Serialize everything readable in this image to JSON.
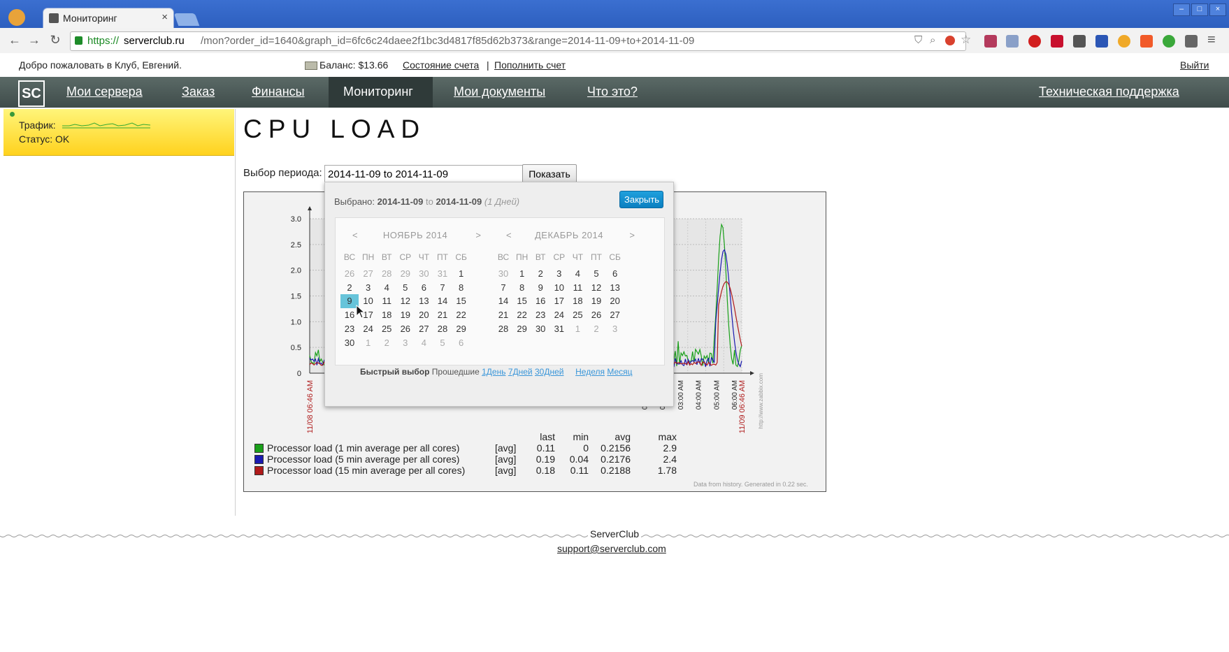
{
  "browser": {
    "tab_title": "Мониторинг",
    "url_protocol": "https://",
    "url_host": "serverclub.ru",
    "url_path": "/mon?order_id=1640&graph_id=6fc6c24daee2f1bc3d4817f85d62b373&range=2014-11-09+to+2014-11-09"
  },
  "header": {
    "welcome": "Добро пожаловать в Клуб, Евгений.",
    "balance": "Баланс: $13.66",
    "account_state": "Состояние счета",
    "separator": "|",
    "top_up": "Пополнить счет",
    "logout": "Выйти"
  },
  "nav": {
    "servers": "Мои сервера",
    "order": "Заказ",
    "finance": "Финансы",
    "monitoring": "Мониторинг",
    "documents": "Мои документы",
    "what": "Что это?",
    "support": "Техническая поддержка"
  },
  "status": {
    "traffic_label": "Трафик:",
    "status_label": "Статус: OK"
  },
  "page": {
    "title": "CPU LOAD",
    "period_label": "Выбор периода:",
    "period_value": "2014-11-09 to 2014-11-09",
    "show_button": "Показать"
  },
  "picker": {
    "selected_label": "Выбрано:",
    "from": "2014-11-09",
    "to_word": "to",
    "to": "2014-11-09",
    "days": "(1 Дней)",
    "close": "Закрыть",
    "quick_label": "Быстрый выбор",
    "past_label": "Прошедшие",
    "q1": "1День",
    "q7": "7Дней",
    "q30": "30Дней",
    "week": "Неделя",
    "month": "Месяц",
    "prev": "<",
    "next": ">",
    "dow": [
      "ВС",
      "ПН",
      "ВТ",
      "СР",
      "ЧТ",
      "ПТ",
      "СБ"
    ],
    "months": [
      {
        "name": "НОЯБРЬ 2014",
        "days": [
          [
            "26",
            "27",
            "28",
            "29",
            "30",
            "31",
            "1"
          ],
          [
            "2",
            "3",
            "4",
            "5",
            "6",
            "7",
            "8"
          ],
          [
            "9",
            "10",
            "11",
            "12",
            "13",
            "14",
            "15"
          ],
          [
            "16",
            "17",
            "18",
            "19",
            "20",
            "21",
            "22"
          ],
          [
            "23",
            "24",
            "25",
            "26",
            "27",
            "28",
            "29"
          ],
          [
            "30",
            "1",
            "2",
            "3",
            "4",
            "5",
            "6"
          ]
        ],
        "muted": [
          [
            0,
            0
          ],
          [
            0,
            1
          ],
          [
            0,
            2
          ],
          [
            0,
            3
          ],
          [
            0,
            4
          ],
          [
            0,
            5
          ],
          [
            5,
            1
          ],
          [
            5,
            2
          ],
          [
            5,
            3
          ],
          [
            5,
            4
          ],
          [
            5,
            5
          ],
          [
            5,
            6
          ]
        ],
        "selected": [
          2,
          0
        ]
      },
      {
        "name": "ДЕКАБРЬ 2014",
        "days": [
          [
            "30",
            "1",
            "2",
            "3",
            "4",
            "5",
            "6"
          ],
          [
            "7",
            "8",
            "9",
            "10",
            "11",
            "12",
            "13"
          ],
          [
            "14",
            "15",
            "16",
            "17",
            "18",
            "19",
            "20"
          ],
          [
            "21",
            "22",
            "23",
            "24",
            "25",
            "26",
            "27"
          ],
          [
            "28",
            "29",
            "30",
            "31",
            "1",
            "2",
            "3"
          ]
        ],
        "muted": [
          [
            0,
            0
          ],
          [
            4,
            4
          ],
          [
            4,
            5
          ],
          [
            4,
            6
          ]
        ],
        "selected": null
      }
    ]
  },
  "chart_data": {
    "type": "line",
    "ylim": [
      0,
      3.0
    ],
    "yticks": [
      "0",
      "0.5",
      "1.0",
      "1.5",
      "2.0",
      "2.5",
      "3.0"
    ],
    "xticks_visible": [
      "01:00 AM",
      "02:00 AM",
      "03:00 AM",
      "04:00 AM",
      "05:00 AM",
      "06:00 AM"
    ],
    "start_label": "11/08 06:46 AM",
    "end_label": "11/09 06:46 AM",
    "watermark": "http://www.zabbix.com",
    "generated": "Data from history. Generated in 0.22 sec.",
    "legend_headers": [
      "last",
      "min",
      "avg",
      "max"
    ],
    "series": [
      {
        "name": "Processor load (1 min average per all cores)",
        "color": "#1aa01a",
        "agg": "[avg]",
        "last": "0.11",
        "min": "0",
        "avg": "0.2156",
        "max": "2.9"
      },
      {
        "name": "Processor load (5 min average per all cores)",
        "color": "#1a1ab0",
        "agg": "[avg]",
        "last": "0.19",
        "min": "0.04",
        "avg": "0.2176",
        "max": "2.4"
      },
      {
        "name": "Processor load (15 min average per all cores)",
        "color": "#b01a1a",
        "agg": "[avg]",
        "last": "0.18",
        "min": "0.11",
        "avg": "0.2188",
        "max": "1.78"
      }
    ]
  },
  "footer": {
    "brand": "ServerClub",
    "email": "support@serverclub.com"
  }
}
